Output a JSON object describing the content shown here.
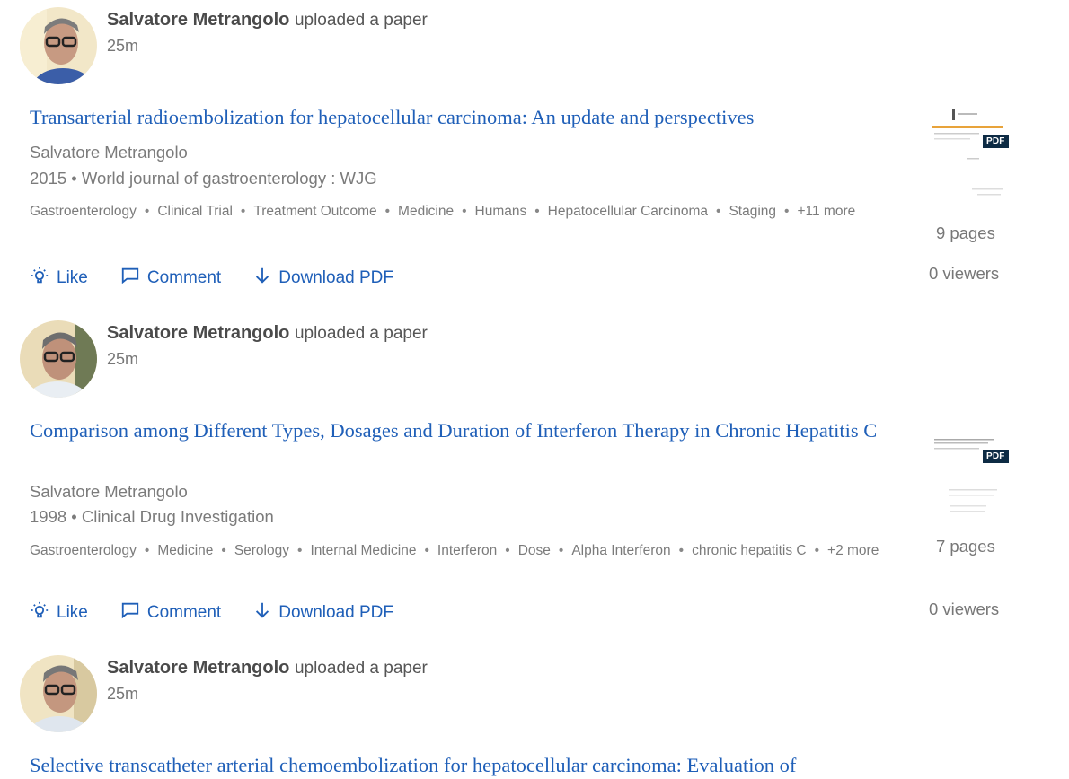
{
  "posts": [
    {
      "author": "Salvatore Metrangolo",
      "action": "uploaded a paper",
      "time": "25m",
      "title": "Transarterial radioembolization for hepatocellular carcinoma: An update and perspectives",
      "authors": "Salvatore Metrangolo",
      "publication": "2015 • World journal of gastroenterology : WJG",
      "tags": [
        "Gastroenterology",
        "Clinical Trial",
        "Treatment Outcome",
        "Medicine",
        "Humans",
        "Hepatocellular Carcinoma",
        "Staging"
      ],
      "more": "+11 more",
      "like": "Like",
      "comment": "Comment",
      "download": "Download PDF",
      "pdf_badge": "PDF",
      "pages": "9 pages",
      "viewers": "0 viewers"
    },
    {
      "author": "Salvatore Metrangolo",
      "action": "uploaded a paper",
      "time": "25m",
      "title": "Comparison among Different Types, Dosages and Duration of Interferon Therapy in Chronic Hepatitis C",
      "authors": "Salvatore Metrangolo",
      "publication": "1998 • Clinical Drug Investigation",
      "tags": [
        "Gastroenterology",
        "Medicine",
        "Serology",
        "Internal Medicine",
        "Interferon",
        "Dose",
        "Alpha Interferon",
        "chronic hepatitis C"
      ],
      "more": "+2 more",
      "like": "Like",
      "comment": "Comment",
      "download": "Download PDF",
      "pdf_badge": "PDF",
      "pages": "7 pages",
      "viewers": "0 viewers"
    },
    {
      "author": "Salvatore Metrangolo",
      "action": "uploaded a paper",
      "time": "25m",
      "title": "Selective transcatheter arterial chemoembolization for hepatocellular carcinoma: Evaluation of"
    }
  ],
  "colors": {
    "link": "#1f5fb8",
    "muted": "#7b7b7b",
    "badge": "#0d2b44"
  },
  "icons": {
    "like": "lightbulb-icon",
    "comment": "comment-icon",
    "download": "download-arrow-icon"
  }
}
